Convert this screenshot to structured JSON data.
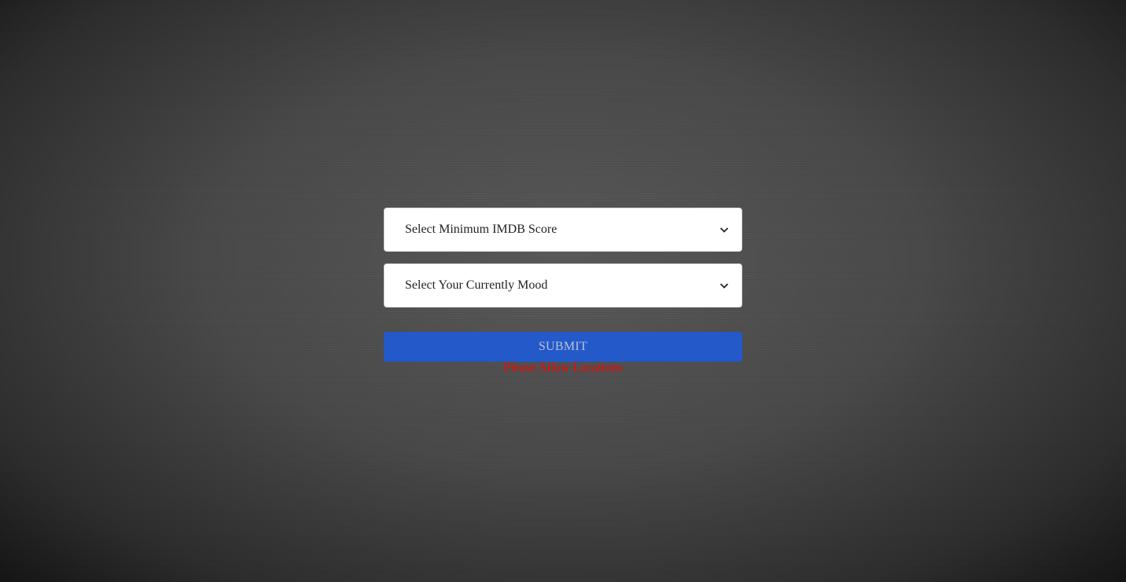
{
  "form": {
    "imdb_select": {
      "placeholder": "Select Minimum IMDB Score",
      "icon": "chevron-down-icon"
    },
    "mood_select": {
      "placeholder": "Select Your Currently Mood",
      "icon": "chevron-down-icon"
    },
    "submit_label": "SUBMIT",
    "error_message": "Please Allow Locations"
  },
  "colors": {
    "submit": "#2359c9",
    "error": "#ff0000"
  }
}
